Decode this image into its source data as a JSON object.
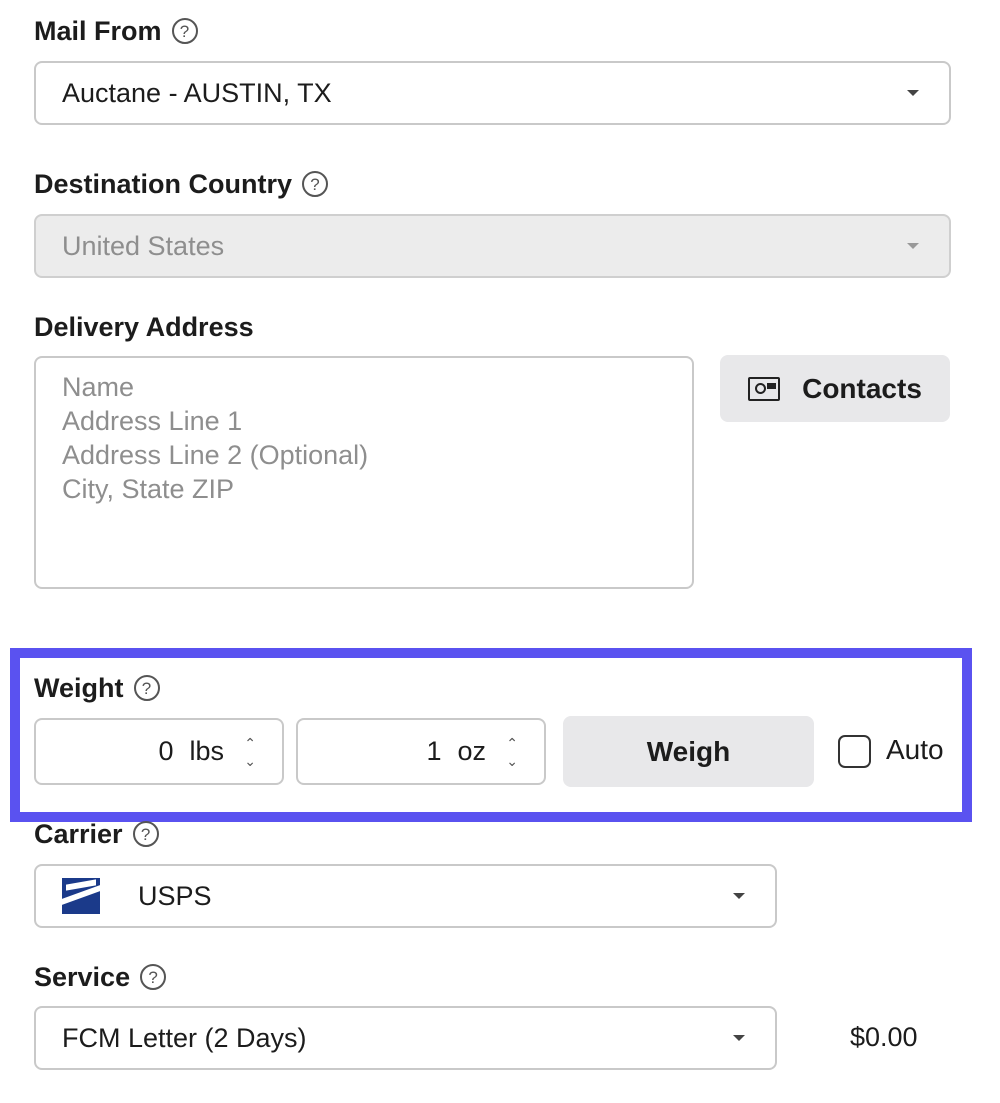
{
  "mail_from": {
    "label": "Mail From",
    "value": "Auctane - AUSTIN, TX",
    "help_icon": "help-icon"
  },
  "destination_country": {
    "label": "Destination Country",
    "value": "United States",
    "disabled": true
  },
  "delivery_address": {
    "label": "Delivery Address",
    "placeholder_lines": [
      "Name",
      "Address Line 1",
      "Address Line 2 (Optional)",
      "City, State ZIP"
    ],
    "contacts_button": "Contacts"
  },
  "weight": {
    "label": "Weight",
    "lbs_value": "0",
    "lbs_unit": "lbs",
    "oz_value": "1",
    "oz_unit": "oz",
    "weigh_button": "Weigh",
    "auto_label": "Auto",
    "auto_checked": false,
    "highlight_color": "#5a52f0"
  },
  "carrier": {
    "label": "Carrier",
    "value": "USPS",
    "logo_color": "#1b3a8a"
  },
  "service": {
    "label": "Service",
    "value": "FCM Letter (2 Days)",
    "price": "$0.00"
  },
  "spinner_glyphs": {
    "up": "⌃",
    "down": "⌄"
  },
  "help_glyph": "?"
}
